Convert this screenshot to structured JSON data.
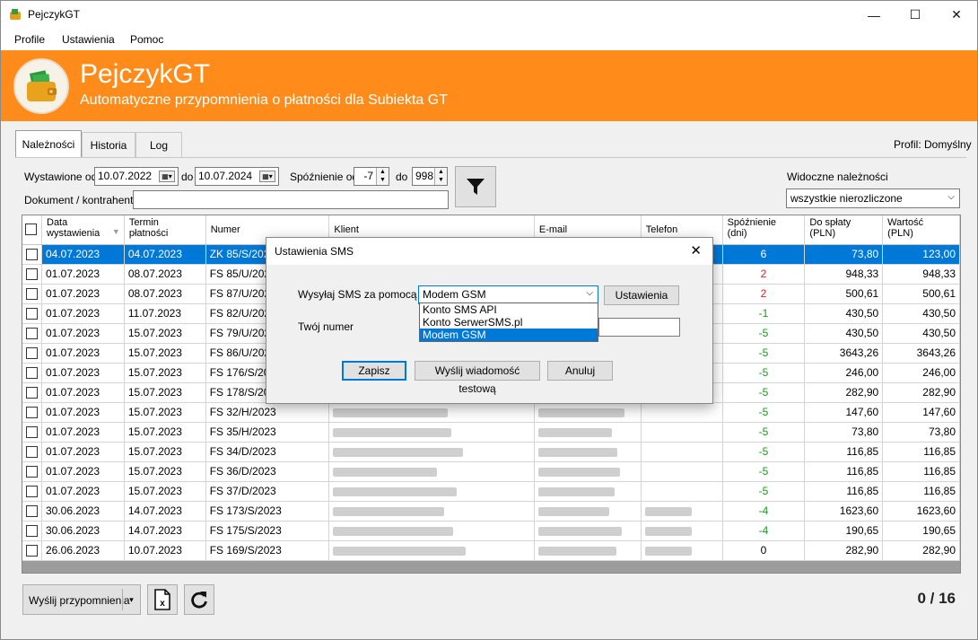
{
  "window": {
    "title": "PejczykGT",
    "minimize": "—",
    "maximize": "☐",
    "close": "✕"
  },
  "menu": [
    "Profile",
    "Ustawienia",
    "Pomoc"
  ],
  "banner": {
    "title": "PejczykGT",
    "subtitle": "Automatyczne przypomnienia o płatności dla  Subiekta GT"
  },
  "tabs": [
    "Należności",
    "Historia",
    "Log"
  ],
  "profile_label": "Profil: Domyślny",
  "filters": {
    "issued_from_label": "Wystawione od",
    "issued_from": "10.07.2022",
    "to_label": "do",
    "issued_to": "10.07.2024",
    "delay_from_label": "Spóźnienie od",
    "delay_from": "-7",
    "delay_to_label": "do",
    "delay_to": "998",
    "doc_label": "Dokument / kontrahent",
    "doc_value": "",
    "visible_label": "Widoczne należności",
    "visible_value": "wszystkie nierozliczone"
  },
  "columns": {
    "issue_date": "Data\nwystawienia",
    "due_date": "Termin\npłatności",
    "number": "Numer",
    "client": "Klient",
    "email": "E-mail",
    "phone": "Telefon",
    "delay": "Spóźnienie\n(dni)",
    "to_pay": "Do spłaty\n(PLN)",
    "value": "Wartość\n(PLN)"
  },
  "rows": [
    {
      "issue": "04.07.2023",
      "due": "04.07.2023",
      "number": "ZK 85/S/2023",
      "delay": "6",
      "delay_color": "black",
      "to_pay": "73,80",
      "value": "123,00",
      "selected": true
    },
    {
      "issue": "01.07.2023",
      "due": "08.07.2023",
      "number": "FS 85/U/2023",
      "delay": "2",
      "delay_color": "red",
      "to_pay": "948,33",
      "value": "948,33"
    },
    {
      "issue": "01.07.2023",
      "due": "08.07.2023",
      "number": "FS 87/U/2023",
      "delay": "2",
      "delay_color": "red",
      "to_pay": "500,61",
      "value": "500,61"
    },
    {
      "issue": "01.07.2023",
      "due": "11.07.2023",
      "number": "FS 82/U/2023",
      "delay": "-1",
      "delay_color": "green",
      "to_pay": "430,50",
      "value": "430,50"
    },
    {
      "issue": "01.07.2023",
      "due": "15.07.2023",
      "number": "FS 79/U/2023",
      "delay": "-5",
      "delay_color": "green",
      "to_pay": "430,50",
      "value": "430,50"
    },
    {
      "issue": "01.07.2023",
      "due": "15.07.2023",
      "number": "FS 86/U/2023",
      "delay": "-5",
      "delay_color": "green",
      "to_pay": "3643,26",
      "value": "3643,26"
    },
    {
      "issue": "01.07.2023",
      "due": "15.07.2023",
      "number": "FS 176/S/2023",
      "delay": "-5",
      "delay_color": "green",
      "to_pay": "246,00",
      "value": "246,00"
    },
    {
      "issue": "01.07.2023",
      "due": "15.07.2023",
      "number": "FS 178/S/2023",
      "delay": "-5",
      "delay_color": "green",
      "to_pay": "282,90",
      "value": "282,90"
    },
    {
      "issue": "01.07.2023",
      "due": "15.07.2023",
      "number": "FS 32/H/2023",
      "delay": "-5",
      "delay_color": "green",
      "to_pay": "147,60",
      "value": "147,60"
    },
    {
      "issue": "01.07.2023",
      "due": "15.07.2023",
      "number": "FS 35/H/2023",
      "delay": "-5",
      "delay_color": "green",
      "to_pay": "73,80",
      "value": "73,80"
    },
    {
      "issue": "01.07.2023",
      "due": "15.07.2023",
      "number": "FS 34/D/2023",
      "delay": "-5",
      "delay_color": "green",
      "to_pay": "116,85",
      "value": "116,85"
    },
    {
      "issue": "01.07.2023",
      "due": "15.07.2023",
      "number": "FS 36/D/2023",
      "delay": "-5",
      "delay_color": "green",
      "to_pay": "116,85",
      "value": "116,85"
    },
    {
      "issue": "01.07.2023",
      "due": "15.07.2023",
      "number": "FS 37/D/2023",
      "delay": "-5",
      "delay_color": "green",
      "to_pay": "116,85",
      "value": "116,85"
    },
    {
      "issue": "30.06.2023",
      "due": "14.07.2023",
      "number": "FS 173/S/2023",
      "delay": "-4",
      "delay_color": "green",
      "to_pay": "1623,60",
      "value": "1623,60"
    },
    {
      "issue": "30.06.2023",
      "due": "14.07.2023",
      "number": "FS 175/S/2023",
      "delay": "-4",
      "delay_color": "green",
      "to_pay": "190,65",
      "value": "190,65"
    },
    {
      "issue": "26.06.2023",
      "due": "10.07.2023",
      "number": "FS 169/S/2023",
      "delay": "0",
      "delay_color": "black",
      "to_pay": "282,90",
      "value": "282,90"
    }
  ],
  "bottom": {
    "send_label": "Wyślij przypomnienia",
    "counter": "0 / 16"
  },
  "dialog": {
    "title": "Ustawienia SMS",
    "send_via_label": "Wysyłaj SMS za pomocą",
    "send_via_value": "Modem GSM",
    "settings_button": "Ustawienia",
    "your_number_label": "Twój numer",
    "your_number_value": "",
    "options": [
      "Konto SMS API",
      "Konto SerwerSMS.pl",
      "Modem GSM"
    ],
    "selected_option": 2,
    "save_button": "Zapisz",
    "test_button": "Wyślij wiadomość testową",
    "cancel_button": "Anuluj"
  },
  "colors": {
    "banner": "#ff8c1a",
    "selection": "#0078d7",
    "late": "#e02020",
    "ok": "#1a9a1a"
  }
}
